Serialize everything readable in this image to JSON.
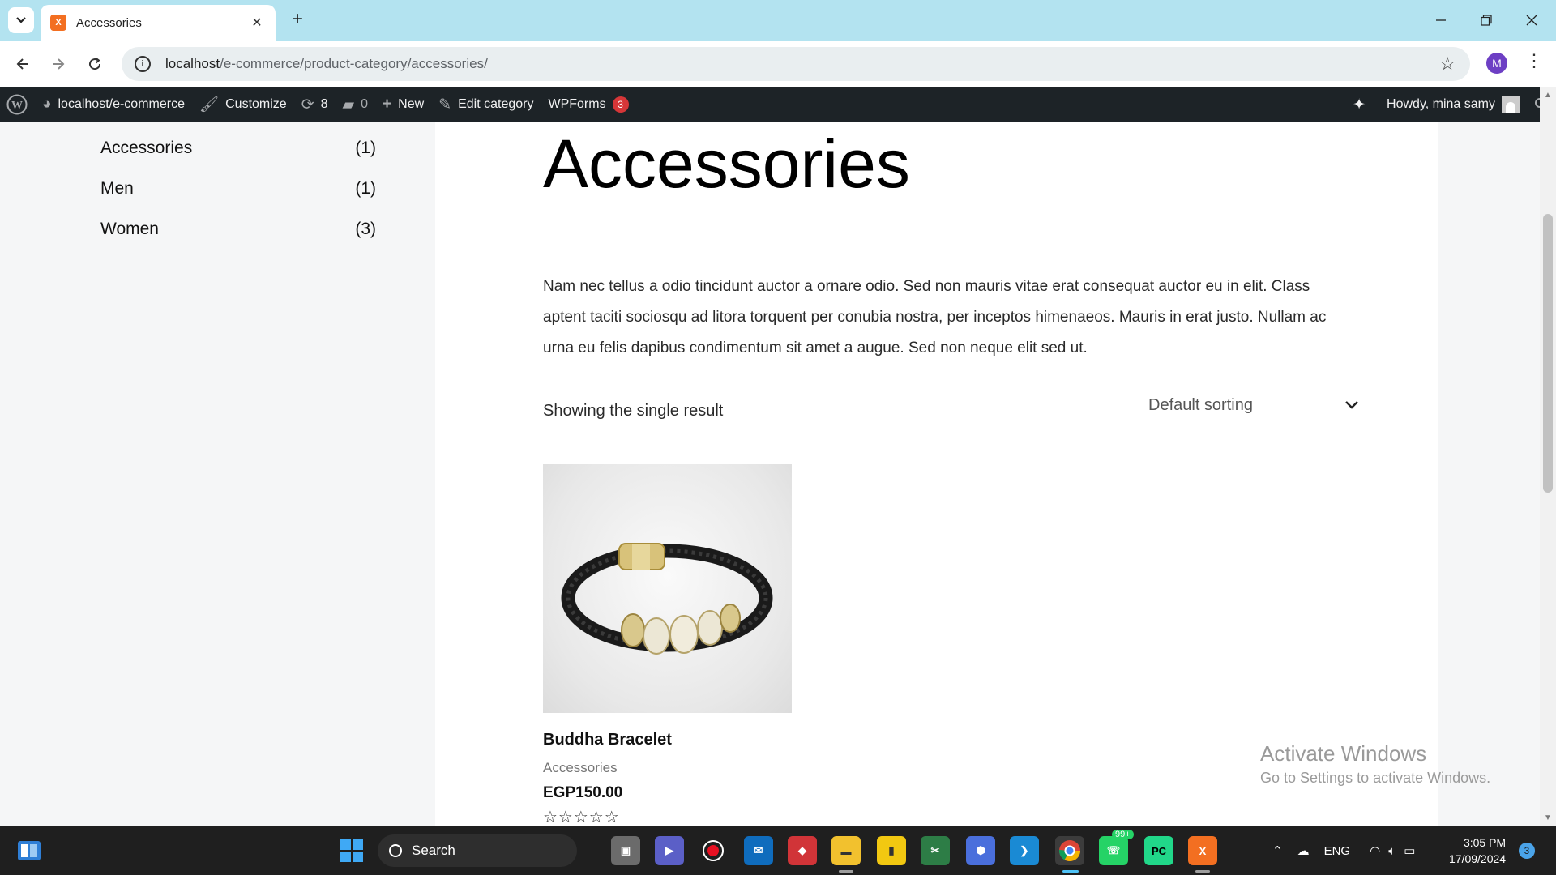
{
  "browser": {
    "tab_title": "Accessories",
    "tab_favicon_text": "X",
    "url_host": "localhost",
    "url_path": "/e-commerce/product-category/accessories/",
    "profile_initial": "M"
  },
  "adminbar": {
    "site_name": "localhost/e-commerce",
    "customize": "Customize",
    "updates_count": "8",
    "comments_count": "0",
    "new": "New",
    "edit_category": "Edit category",
    "wpforms": "WPForms",
    "wpforms_badge": "3",
    "howdy": "Howdy, mina samy"
  },
  "sidebar": {
    "categories": [
      {
        "name": "Accessories",
        "count": "(1)"
      },
      {
        "name": "Men",
        "count": "(1)"
      },
      {
        "name": "Women",
        "count": "(3)"
      }
    ]
  },
  "main": {
    "title": "Accessories",
    "description": "Nam nec tellus a odio tincidunt auctor a ornare odio. Sed non mauris vitae erat consequat auctor eu in elit. Class aptent taciti sociosqu ad litora torquent per conubia nostra, per inceptos himenaeos. Mauris in erat justo. Nullam ac urna eu felis dapibus condimentum sit amet a augue. Sed non neque elit sed ut.",
    "result_count": "Showing the single result",
    "sorting_selected": "Default sorting",
    "product": {
      "title": "Buddha Bracelet",
      "category": "Accessories",
      "price": "EGP150.00",
      "rating_stars": "☆☆☆☆☆"
    }
  },
  "watermark": {
    "line1": "Activate Windows",
    "line2": "Go to Settings to activate Windows."
  },
  "taskbar": {
    "search_label": "Search",
    "whatsapp_badge": "99+",
    "language": "ENG",
    "time": "3:05 PM",
    "date": "17/09/2024",
    "notification_count": "3"
  }
}
